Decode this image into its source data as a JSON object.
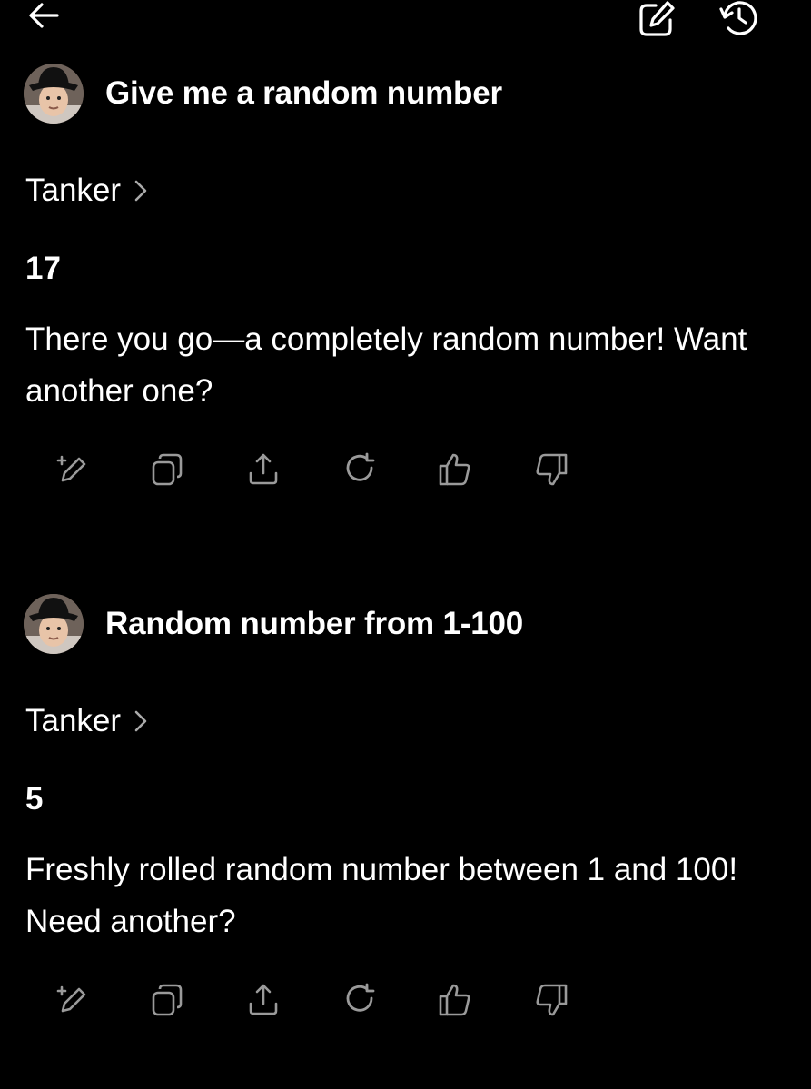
{
  "topbar": {
    "back_icon": "arrow-left-icon",
    "new_chat_icon": "edit-square-icon",
    "history_icon": "history-clock-icon"
  },
  "turns": [
    {
      "prompt": "Give me a random number",
      "model": "Tanker",
      "answer_number": "17",
      "answer_text": "There you go—a completely random number! Want another one?"
    },
    {
      "prompt": "Random number from 1-100",
      "model": "Tanker",
      "answer_number": "5",
      "answer_text": "Freshly rolled random number between 1 and 100! Need another?"
    }
  ],
  "action_icons": [
    "edit-sparkle-icon",
    "copy-icon",
    "share-icon",
    "regenerate-icon",
    "thumbs-up-icon",
    "thumbs-down-icon"
  ],
  "colors": {
    "background": "#000000",
    "text": "#ffffff",
    "icon": "#9a9a9a"
  }
}
